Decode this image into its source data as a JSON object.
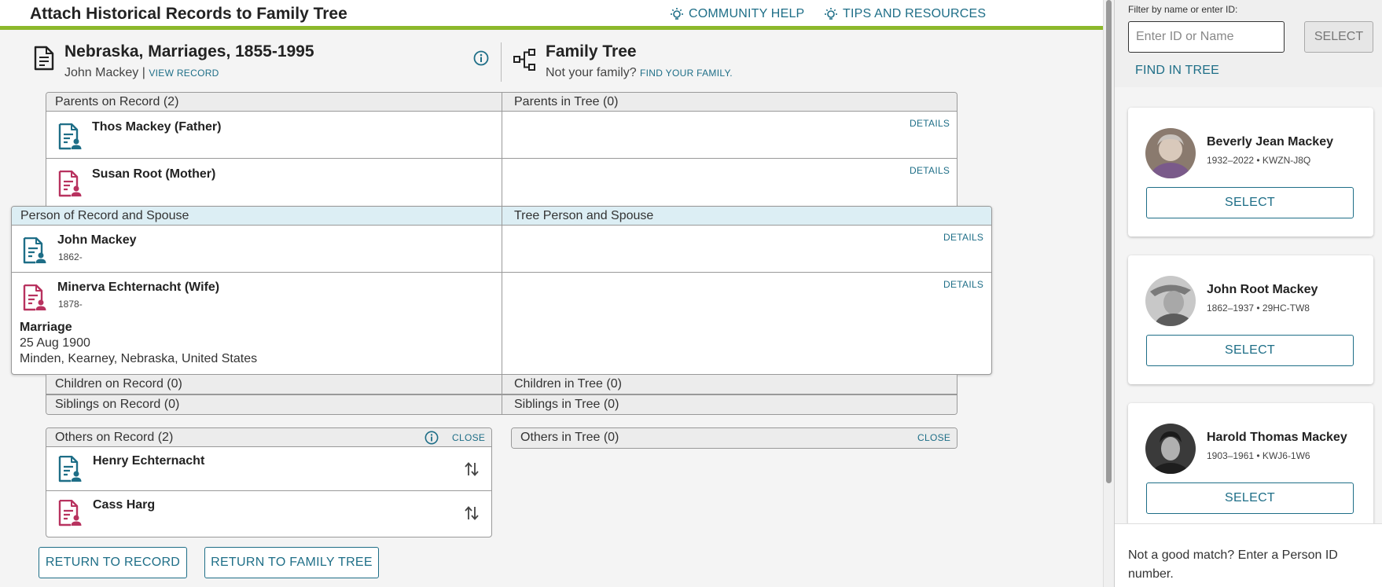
{
  "app": {
    "title": "Attach Historical Records to Family Tree",
    "community_help": "COMMUNITY HELP",
    "tips": "TIPS AND RESOURCES"
  },
  "record": {
    "title": "Nebraska, Marriages, 1855-1995",
    "person": "John Mackey",
    "separator": "|",
    "view_link": "VIEW RECORD"
  },
  "tree": {
    "title": "Family Tree",
    "not_family": "Not your family?",
    "find_link": "FIND YOUR FAMILY."
  },
  "parents": {
    "record_label": "Parents on Record (2)",
    "tree_label": "Parents in Tree (0)",
    "rows": [
      {
        "name": "Thos Mackey (Father)",
        "details": "DETAILS"
      },
      {
        "name": "Susan Root (Mother)",
        "details": "DETAILS"
      }
    ]
  },
  "focus": {
    "record_label": "Person of Record and Spouse",
    "tree_label": "Tree Person and Spouse",
    "rows": [
      {
        "name": "John Mackey",
        "date": "1862-",
        "details": "DETAILS"
      },
      {
        "name": "Minerva Echternacht (Wife)",
        "date": "1878-",
        "details": "DETAILS"
      }
    ],
    "marriage": {
      "label": "Marriage",
      "date": "25 Aug 1900",
      "place": "Minden, Kearney, Nebraska, United States"
    }
  },
  "children": {
    "record_label": "Children on Record (0)",
    "tree_label": "Children in Tree (0)"
  },
  "siblings": {
    "record_label": "Siblings on Record (0)",
    "tree_label": "Siblings in Tree (0)"
  },
  "others": {
    "record_label": "Others on Record (2)",
    "tree_label": "Others in Tree (0)",
    "close": "CLOSE",
    "rows": [
      {
        "name": "Henry Echternacht"
      },
      {
        "name": "Cass Harg"
      }
    ]
  },
  "buttons": {
    "return_record": "RETURN TO RECORD",
    "return_tree": "RETURN TO FAMILY TREE"
  },
  "panel": {
    "filter_label": "Filter by name or enter ID:",
    "input_placeholder": "Enter ID or Name",
    "select": "SELECT",
    "find_in_tree": "FIND IN TREE",
    "cards": [
      {
        "name": "Beverly Jean Mackey",
        "meta": "1932–2022 • KWZN-J8Q",
        "button": "SELECT"
      },
      {
        "name": "John Root Mackey",
        "meta": "1862–1937 • 29HC-TW8",
        "button": "SELECT"
      },
      {
        "name": "Harold Thomas Mackey",
        "meta": "1903–1961 • KWJ6-1W6",
        "button": "SELECT"
      }
    ],
    "not_match": "Not a good match? Enter a Person ID number."
  },
  "colors": {
    "accent_green": "#8cb82b",
    "link_teal": "#1e6e87",
    "male_icon": "#1e6e87",
    "female_icon": "#b8325f",
    "focus_header": "#dceef4"
  }
}
